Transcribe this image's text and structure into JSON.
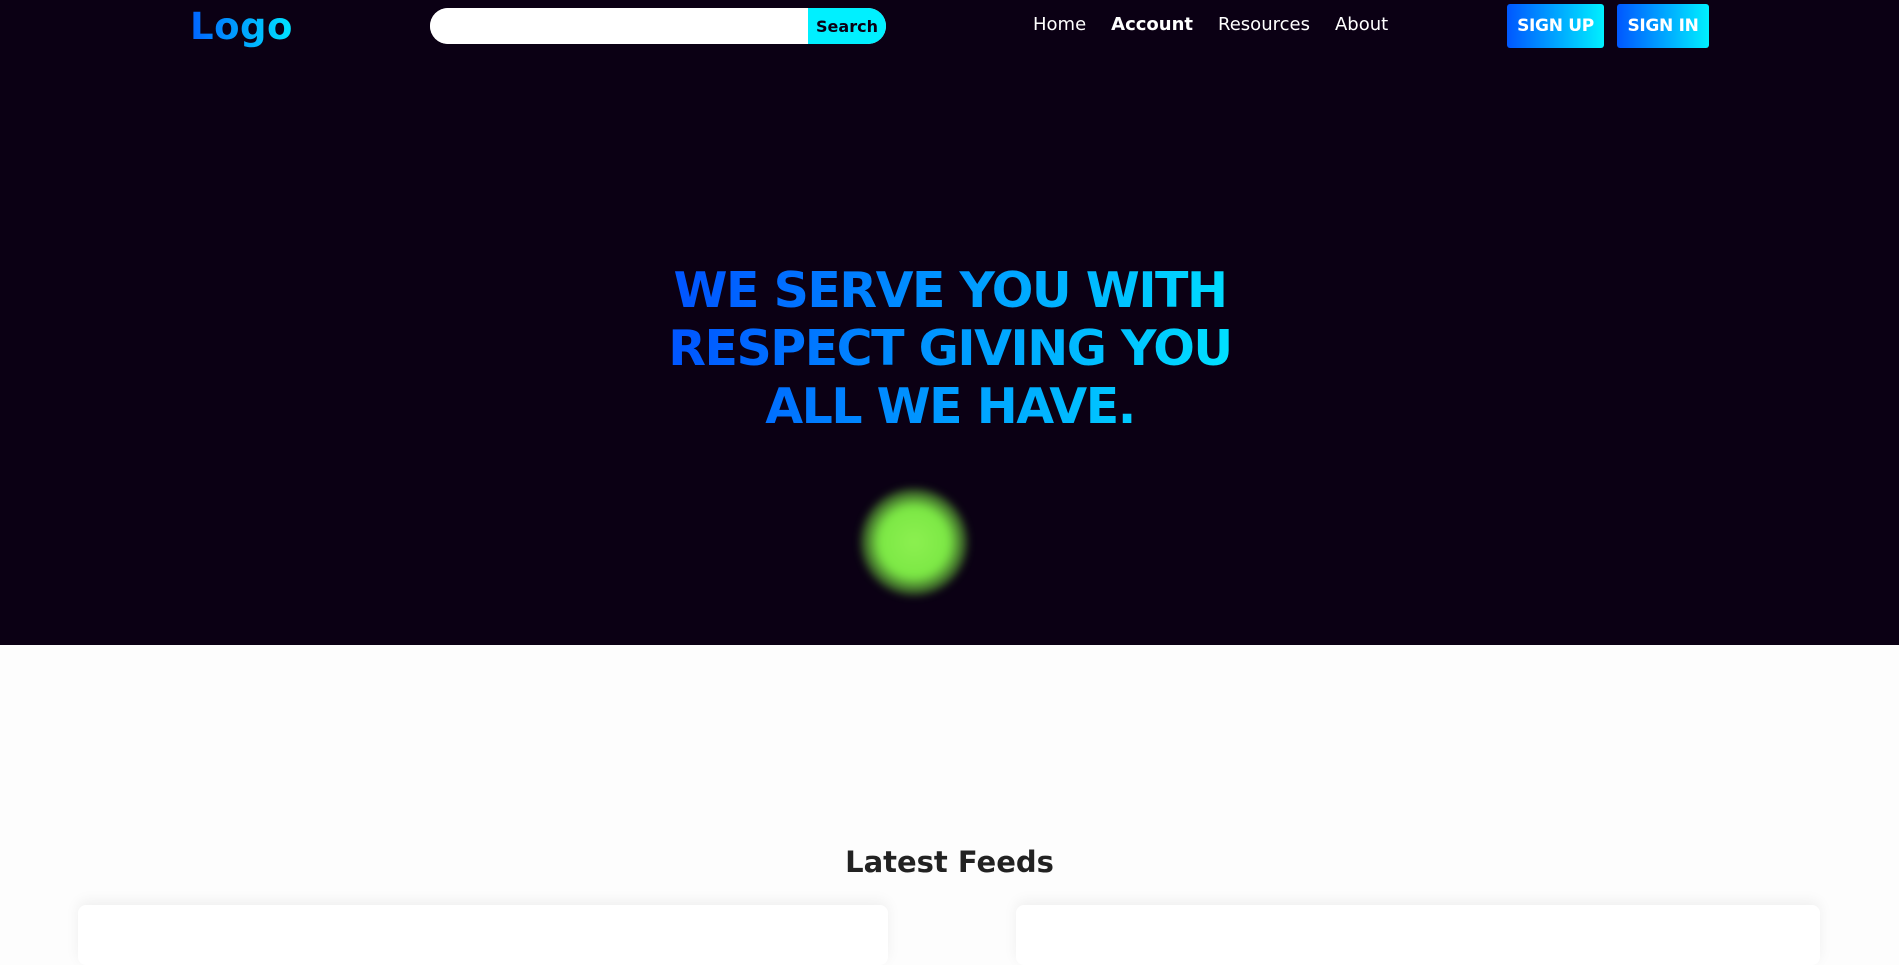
{
  "header": {
    "logo": "Logo",
    "search": {
      "placeholder": "",
      "button_label": "Search"
    },
    "nav": [
      {
        "label": "Home",
        "active": false
      },
      {
        "label": "Account",
        "active": true
      },
      {
        "label": "Resources",
        "active": false
      },
      {
        "label": "About",
        "active": false
      }
    ],
    "signup_label": "SIGN UP",
    "signin_label": "SIGN IN"
  },
  "hero": {
    "headline_lines": [
      "WE SERVE YOU WITH",
      "RESPECT GIVING YOU",
      "ALL WE HAVE."
    ]
  },
  "feeds": {
    "title": "Latest Feeds"
  },
  "colors": {
    "hero_background": "#0b0014",
    "accent_blue": "#0057ff",
    "accent_cyan": "#00f0ff",
    "glow_green": "#7ce845"
  }
}
